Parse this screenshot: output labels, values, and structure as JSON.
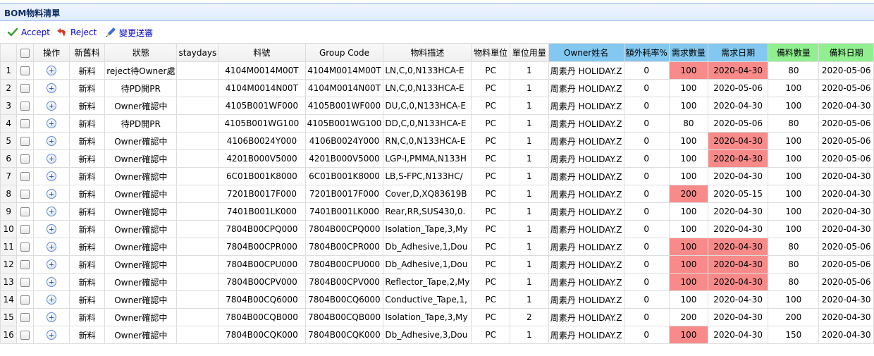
{
  "panel_title": "BOM物料清單",
  "toolbar": {
    "accept_label": "Accept",
    "reject_label": "Reject",
    "change_label": "變更送審"
  },
  "columns": [
    "",
    "",
    "操作",
    "新舊料",
    "狀態",
    "staydays",
    "料號",
    "Group Code",
    "物料描述",
    "物料單位",
    "單位用量",
    "Owner姓名",
    "額外耗率%",
    "需求數量",
    "需求日期",
    "備料數量",
    "備料日期"
  ],
  "colors": {
    "owner_header": "#82c8f0",
    "backup_header": "#90f090",
    "highlight": "#f88a8a"
  },
  "rows": [
    {
      "no": "1",
      "type": "新料",
      "status": "reject待Owner處",
      "stay": "",
      "part": "4104M0014M00T",
      "group": "4104M0014M00T",
      "desc": "LN,C,0,N133HCA-E",
      "unit": "PC",
      "usage": "1",
      "owner": "周素丹 HOLIDAY.Z",
      "extra": "0",
      "qty": "100",
      "qty_red": true,
      "date": "2020-04-30",
      "date_red": true,
      "bqty": "80",
      "bdate": "2020-05-06"
    },
    {
      "no": "2",
      "type": "新料",
      "status": "待PD開PR",
      "stay": "",
      "part": "4104M0014N00T",
      "group": "4104M0014N00T",
      "desc": "LN,C,0,N133HCA-E",
      "unit": "PC",
      "usage": "1",
      "owner": "周素丹 HOLIDAY.Z",
      "extra": "0",
      "qty": "100",
      "qty_red": false,
      "date": "2020-05-06",
      "date_red": false,
      "bqty": "100",
      "bdate": "2020-05-06"
    },
    {
      "no": "3",
      "type": "新料",
      "status": "Owner確認中",
      "stay": "",
      "part": "4105B001WF000",
      "group": "4105B001WF000",
      "desc": "DU,C,0,N133HCA-E",
      "unit": "PC",
      "usage": "1",
      "owner": "周素丹 HOLIDAY.Z",
      "extra": "0",
      "qty": "100",
      "qty_red": false,
      "date": "2020-04-30",
      "date_red": false,
      "bqty": "100",
      "bdate": "2020-04-30"
    },
    {
      "no": "4",
      "type": "新料",
      "status": "待PD開PR",
      "stay": "",
      "part": "4105B001WG100",
      "group": "4105B001WG100",
      "desc": "DD,C,0,N133HCA-E",
      "unit": "PC",
      "usage": "1",
      "owner": "周素丹 HOLIDAY.Z",
      "extra": "0",
      "qty": "80",
      "qty_red": false,
      "date": "2020-05-06",
      "date_red": false,
      "bqty": "80",
      "bdate": "2020-05-06"
    },
    {
      "no": "5",
      "type": "新料",
      "status": "Owner確認中",
      "stay": "",
      "part": "4106B0024Y000",
      "group": "4106B0024Y000",
      "desc": "RN,C,0,N133HCA-E",
      "unit": "PC",
      "usage": "1",
      "owner": "周素丹 HOLIDAY.Z",
      "extra": "0",
      "qty": "100",
      "qty_red": false,
      "date": "2020-04-30",
      "date_red": true,
      "bqty": "100",
      "bdate": "2020-05-06"
    },
    {
      "no": "6",
      "type": "新料",
      "status": "Owner確認中",
      "stay": "",
      "part": "4201B000V5000",
      "group": "4201B000V5000",
      "desc": "LGP-I,PMMA,N133H",
      "unit": "PC",
      "usage": "1",
      "owner": "周素丹 HOLIDAY.Z",
      "extra": "0",
      "qty": "100",
      "qty_red": false,
      "date": "2020-04-30",
      "date_red": true,
      "bqty": "100",
      "bdate": "2020-05-06"
    },
    {
      "no": "7",
      "type": "新料",
      "status": "Owner確認中",
      "stay": "",
      "part": "6C01B001K8000",
      "group": "6C01B001K8000",
      "desc": "LB,S-FPC,N133HC/",
      "unit": "PC",
      "usage": "1",
      "owner": "周素丹 HOLIDAY.Z",
      "extra": "0",
      "qty": "100",
      "qty_red": false,
      "date": "2020-04-30",
      "date_red": false,
      "bqty": "100",
      "bdate": "2020-04-30"
    },
    {
      "no": "8",
      "type": "新料",
      "status": "Owner確認中",
      "stay": "",
      "part": "7201B0017F000",
      "group": "7201B0017F000",
      "desc": "Cover,D,XQ83619B",
      "unit": "PC",
      "usage": "1",
      "owner": "周素丹 HOLIDAY.Z",
      "extra": "0",
      "qty": "200",
      "qty_red": true,
      "date": "2020-05-15",
      "date_red": false,
      "bqty": "100",
      "bdate": "2020-04-30"
    },
    {
      "no": "9",
      "type": "新料",
      "status": "Owner確認中",
      "stay": "",
      "part": "7401B001LK000",
      "group": "7401B001LK000",
      "desc": "Rear,RR,SUS430,0.",
      "unit": "PC",
      "usage": "1",
      "owner": "周素丹 HOLIDAY.Z",
      "extra": "0",
      "qty": "100",
      "qty_red": false,
      "date": "2020-04-30",
      "date_red": false,
      "bqty": "100",
      "bdate": "2020-04-30"
    },
    {
      "no": "10",
      "type": "新料",
      "status": "Owner確認中",
      "stay": "",
      "part": "7804B00CPQ000",
      "group": "7804B00CPQ000",
      "desc": "Isolation_Tape,3,My",
      "unit": "PC",
      "usage": "1",
      "owner": "周素丹 HOLIDAY.Z",
      "extra": "0",
      "qty": "100",
      "qty_red": false,
      "date": "2020-04-30",
      "date_red": false,
      "bqty": "100",
      "bdate": "2020-04-30"
    },
    {
      "no": "11",
      "type": "新料",
      "status": "Owner確認中",
      "stay": "",
      "part": "7804B00CPR000",
      "group": "7804B00CPR000",
      "desc": "Db_Adhesive,1,Dou",
      "unit": "PC",
      "usage": "1",
      "owner": "周素丹 HOLIDAY.Z",
      "extra": "0",
      "qty": "100",
      "qty_red": true,
      "date": "2020-04-30",
      "date_red": true,
      "bqty": "80",
      "bdate": "2020-05-06"
    },
    {
      "no": "12",
      "type": "新料",
      "status": "Owner確認中",
      "stay": "",
      "part": "7804B00CPU000",
      "group": "7804B00CPU000",
      "desc": "Db_Adhesive,1,Dou",
      "unit": "PC",
      "usage": "1",
      "owner": "周素丹 HOLIDAY.Z",
      "extra": "0",
      "qty": "100",
      "qty_red": true,
      "date": "2020-04-30",
      "date_red": true,
      "bqty": "80",
      "bdate": "2020-05-06"
    },
    {
      "no": "13",
      "type": "新料",
      "status": "Owner確認中",
      "stay": "",
      "part": "7804B00CPV000",
      "group": "7804B00CPV000",
      "desc": "Reflector_Tape,2,My",
      "unit": "PC",
      "usage": "1",
      "owner": "周素丹 HOLIDAY.Z",
      "extra": "0",
      "qty": "100",
      "qty_red": true,
      "date": "2020-04-30",
      "date_red": true,
      "bqty": "80",
      "bdate": "2020-05-06"
    },
    {
      "no": "14",
      "type": "新料",
      "status": "Owner確認中",
      "stay": "",
      "part": "7804B00CQ6000",
      "group": "7804B00CQ6000",
      "desc": "Conductive_Tape,1,",
      "unit": "PC",
      "usage": "1",
      "owner": "周素丹 HOLIDAY.Z",
      "extra": "0",
      "qty": "100",
      "qty_red": false,
      "date": "2020-04-30",
      "date_red": false,
      "bqty": "100",
      "bdate": "2020-04-30"
    },
    {
      "no": "15",
      "type": "新料",
      "status": "Owner確認中",
      "stay": "",
      "part": "7804B00CQB000",
      "group": "7804B00CQB000",
      "desc": "Isolation_Tape,3,My",
      "unit": "PC",
      "usage": "2",
      "owner": "周素丹 HOLIDAY.Z",
      "extra": "0",
      "qty": "200",
      "qty_red": false,
      "date": "2020-04-30",
      "date_red": false,
      "bqty": "200",
      "bdate": "2020-04-30"
    },
    {
      "no": "16",
      "type": "新料",
      "status": "Owner確認中",
      "stay": "",
      "part": "7804B00CQK000",
      "group": "7804B00CQK000",
      "desc": "Db_Adhesive,3,Dou",
      "unit": "PC",
      "usage": "1",
      "owner": "周素丹 HOLIDAY.Z",
      "extra": "0",
      "qty": "100",
      "qty_red": true,
      "date": "2020-04-30",
      "date_red": false,
      "bqty": "150",
      "bdate": "2020-04-30"
    }
  ]
}
